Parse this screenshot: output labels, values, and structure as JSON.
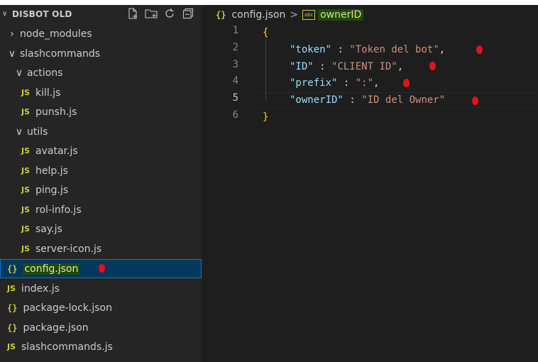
{
  "explorer": {
    "title": "DISBOT OLD",
    "actions": [
      "new-file-icon",
      "new-folder-icon",
      "refresh-icon",
      "collapse-all-icon"
    ],
    "items": [
      {
        "label": "node_modules",
        "kind": "folder-collapsed"
      },
      {
        "label": "slashcommands",
        "kind": "folder-expanded"
      },
      {
        "label": "actions",
        "kind": "folder-expanded"
      },
      {
        "label": "kill.js",
        "kind": "js"
      },
      {
        "label": "punsh.js",
        "kind": "js"
      },
      {
        "label": "utils",
        "kind": "folder-expanded"
      },
      {
        "label": "avatar.js",
        "kind": "js"
      },
      {
        "label": "help.js",
        "kind": "js"
      },
      {
        "label": "ping.js",
        "kind": "js"
      },
      {
        "label": "rol-info.js",
        "kind": "js"
      },
      {
        "label": "say.js",
        "kind": "js"
      },
      {
        "label": "server-icon.js",
        "kind": "js"
      },
      {
        "label": "config.json",
        "kind": "json",
        "selected": true
      },
      {
        "label": "index.js",
        "kind": "js"
      },
      {
        "label": "package-lock.json",
        "kind": "json"
      },
      {
        "label": "package.json",
        "kind": "json"
      },
      {
        "label": "slashcommands.js",
        "kind": "js"
      }
    ],
    "js_badge": "JS",
    "json_badge": "{}"
  },
  "breadcrumb": {
    "file": "config.json",
    "separator": ">",
    "symbol_badge": "abc",
    "symbol": "ownerID"
  },
  "editor": {
    "line_numbers": [
      "1",
      "2",
      "3",
      "4",
      "5",
      "6"
    ],
    "active_line": "5",
    "lines": {
      "l1": "{",
      "l2_key": "\"token\"",
      "l2_sep": " : ",
      "l2_val": "\"Token del bot\"",
      "l2_end": ",",
      "l3_key": "\"ID\"",
      "l3_sep": " : ",
      "l3_val": "\"CLIENT ID\"",
      "l3_end": ",",
      "l4_key": "\"prefix\"",
      "l4_sep": " : ",
      "l4_val": "\":\"",
      "l4_end": ",",
      "l5_key": "\"ownerID\"",
      "l5_sep": " : ",
      "l5_val": "\"ID del Owner\"",
      "l6": "}"
    }
  },
  "colors": {
    "sidebar_bg": "#252526",
    "editor_bg": "#1e1e1e",
    "selection": "#04395e",
    "json_key": "#9cdcfe",
    "json_string": "#ce9178",
    "brace": "#ffd700",
    "annotation_dot": "#e8111a"
  }
}
